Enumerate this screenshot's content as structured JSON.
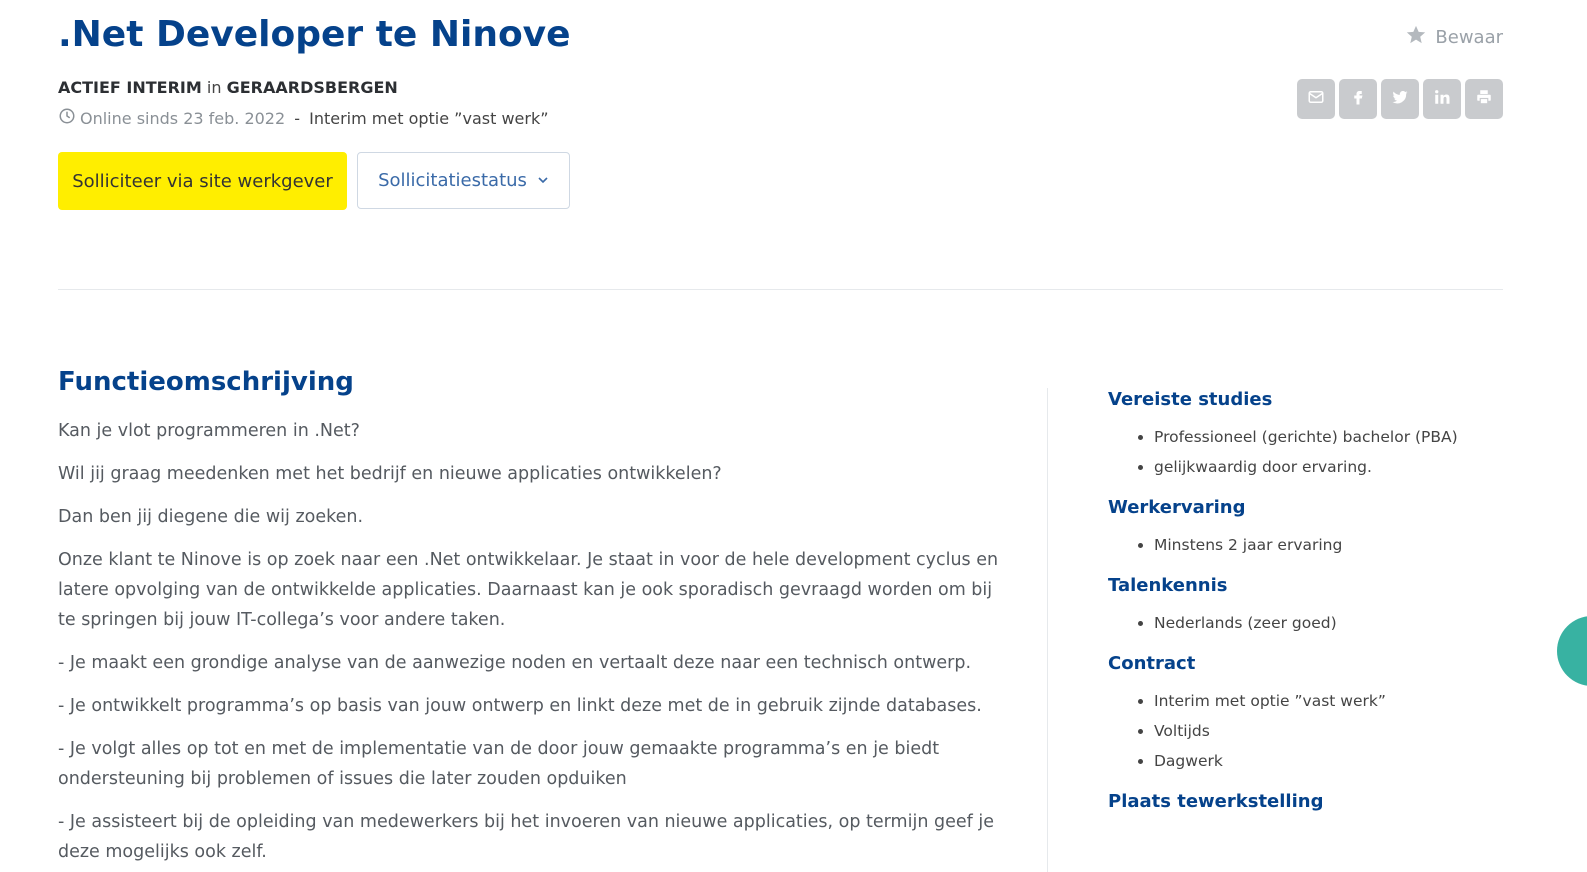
{
  "job": {
    "title": ".Net Developer te Ninove",
    "company": "ACTIEF INTERIM",
    "in_word": "in",
    "location": "GERAARDSBERGEN",
    "online_since": "Online sinds 23 feb. 2022",
    "separator": " - ",
    "contract_type": "Interim met optie ”vast werk”"
  },
  "actions": {
    "save_label": "Bewaar",
    "apply_label": "Solliciteer via site werkgever",
    "status_label": "Sollicitatiestatus",
    "share_icons": [
      "mail-icon",
      "facebook-icon",
      "twitter-icon",
      "linkedin-icon",
      "print-icon"
    ]
  },
  "description": {
    "heading": "Functieomschrijving",
    "paragraphs": [
      "Kan je vlot programmeren in .Net?",
      "Wil jij graag meedenken met het bedrijf en nieuwe applicaties ontwikkelen?",
      "Dan ben jij diegene die wij zoeken.",
      "Onze klant te Ninove is op zoek naar een .Net ontwikkelaar. Je staat in voor de hele development cyclus en latere opvolging van de ontwikkelde applicaties. Daarnaast kan je ook sporadisch gevraagd worden om bij te springen bij jouw IT-collega’s voor andere taken.",
      "- Je maakt een grondige analyse van de aanwezige noden en vertaalt deze naar een technisch ontwerp.",
      "- Je ontwikkelt programma’s op basis van jouw ontwerp en linkt deze met de in gebruik zijnde databases.",
      "- Je volgt alles op tot en met de implementatie van de door jouw gemaakte programma’s en je biedt ondersteuning bij problemen of issues die later zouden opduiken",
      "- Je assisteert bij de opleiding van medewerkers bij het invoeren van nieuwe applicaties, op termijn geef je deze mogelijks ook zelf."
    ]
  },
  "sidebar": {
    "studies": {
      "heading": "Vereiste studies",
      "items": [
        "Professioneel (gerichte) bachelor (PBA)",
        "gelijkwaardig door ervaring."
      ]
    },
    "experience": {
      "heading": "Werkervaring",
      "items": [
        "Minstens 2 jaar ervaring"
      ]
    },
    "languages": {
      "heading": "Talenkennis",
      "items": [
        "Nederlands (zeer goed)"
      ]
    },
    "contract": {
      "heading": "Contract",
      "items": [
        "Interim met optie ”vast werk”",
        "Voltijds",
        "Dagwerk"
      ]
    },
    "workplace": {
      "heading": "Plaats tewerkstelling"
    }
  },
  "colors": {
    "title_blue": "#05428b",
    "apply_yellow": "#ffee00",
    "share_grey": "#c9cbce",
    "fab_teal": "#38b2a2"
  }
}
